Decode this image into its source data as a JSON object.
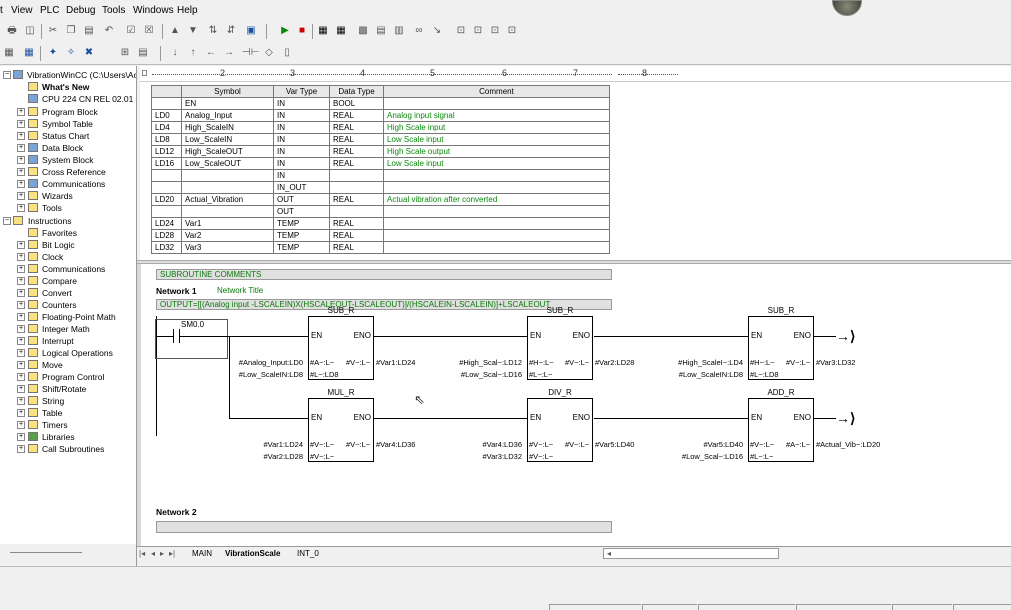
{
  "menu": [
    "t",
    "View",
    "PLC",
    "Debug",
    "Tools",
    "Windows",
    "Help"
  ],
  "toolbar": {
    "row1": [
      "printer-icon",
      "print-preview-icon",
      "cut-icon",
      "copy-icon",
      "paste-icon",
      "undo-icon",
      "compile-icon",
      "compile-all-icon",
      "upload-icon",
      "download-icon",
      "sort-asc-icon",
      "sort-desc-icon",
      "options-icon",
      "run-icon",
      "stop-icon",
      "program-status-icon",
      "chart-status-icon",
      "monitor-icon",
      "trend-icon",
      "force-icon",
      "glasses-icon",
      "unforce-icon",
      "lock-icon",
      "read-icon",
      "write-icon"
    ],
    "row2": [
      "ladder-icon",
      "stl-icon",
      "insert-network-icon",
      "delete-network-icon",
      "insert-col-icon",
      "symbol-icon",
      "symbol-table-icon",
      "line-down-icon",
      "line-up-icon",
      "line-left-icon",
      "line-right-icon",
      "contact-icon",
      "coil-icon",
      "box-icon"
    ]
  },
  "tree": {
    "root": "VibrationWinCC (C:\\Users\\Ac",
    "items": [
      {
        "label": "What's New",
        "bold": true
      },
      {
        "label": "CPU 224 CN REL 02.01"
      },
      {
        "label": "Program Block"
      },
      {
        "label": "Symbol Table"
      },
      {
        "label": "Status Chart"
      },
      {
        "label": "Data Block"
      },
      {
        "label": "System Block"
      },
      {
        "label": "Cross Reference"
      },
      {
        "label": "Communications"
      },
      {
        "label": "Wizards"
      },
      {
        "label": "Tools"
      }
    ],
    "instructions_label": "Instructions",
    "instructions": [
      "Favorites",
      "Bit Logic",
      "Clock",
      "Communications",
      "Compare",
      "Convert",
      "Counters",
      "Floating-Point Math",
      "Integer Math",
      "Interrupt",
      "Logical Operations",
      "Move",
      "Program Control",
      "Shift/Rotate",
      "String",
      "Table",
      "Timers",
      "Libraries",
      "Call Subroutines"
    ]
  },
  "ruler": [
    "2",
    "3",
    "4",
    "5",
    "6",
    "7",
    "8"
  ],
  "var_table": {
    "headers": [
      "",
      "Symbol",
      "Var Type",
      "Data Type",
      "Comment"
    ],
    "rows": [
      [
        "",
        "EN",
        "IN",
        "BOOL",
        ""
      ],
      [
        "LD0",
        "Analog_Input",
        "IN",
        "REAL",
        "Analog input signal"
      ],
      [
        "LD4",
        "High_ScaleIN",
        "IN",
        "REAL",
        "High Scale input"
      ],
      [
        "LD8",
        "Low_ScaleIN",
        "IN",
        "REAL",
        "Low Scale input"
      ],
      [
        "LD12",
        "High_ScaleOUT",
        "IN",
        "REAL",
        "High Scale output"
      ],
      [
        "LD16",
        "Low_ScaleOUT",
        "IN",
        "REAL",
        "Low Scale input"
      ],
      [
        "",
        "",
        "IN",
        "",
        ""
      ],
      [
        "",
        "",
        "IN_OUT",
        "",
        ""
      ],
      [
        "LD20",
        "Actual_Vibration",
        "OUT",
        "REAL",
        "Actual vibration after converted"
      ],
      [
        "",
        "",
        "OUT",
        "",
        ""
      ],
      [
        "LD24",
        "Var1",
        "TEMP",
        "REAL",
        ""
      ],
      [
        "LD28",
        "Var2",
        "TEMP",
        "REAL",
        ""
      ],
      [
        "LD32",
        "Var3",
        "TEMP",
        "REAL",
        ""
      ]
    ]
  },
  "editor": {
    "subroutine_comments": "SUBROUTINE COMMENTS",
    "network1": "Network 1",
    "network1_title": "Network Title",
    "formula": "OUTPUT=[[(Analog input -LSCALEIN)X(HSCALEOUT-LSCALEOUT)]/(HSCALEIN-LSCALEIN)]+LSCALEOUT",
    "contact": "SM0.0",
    "boxes": [
      {
        "name": "SUB_R",
        "in1": "#Analog_Input:LD0",
        "in2": "#Low_ScaleIN:LD8",
        "p1": "#A~:L~",
        "p2": "#L~:LD8",
        "po": "#V~:L~",
        "out": "#Var1:LD24"
      },
      {
        "name": "SUB_R",
        "in1": "#High_Scal~:LD12",
        "in2": "#Low_Scal~:LD16",
        "p1": "#H~:L~",
        "p2": "#L~:L~",
        "po": "#V~:L~",
        "out": "#Var2:LD28"
      },
      {
        "name": "SUB_R",
        "in1": "#High_ScaleI~:LD4",
        "in2": "#Low_ScaleIN:LD8",
        "p1": "#H~:L~",
        "p2": "#L~:LD8",
        "po": "#V~:L~",
        "out": "#Var3:LD32"
      },
      {
        "name": "MUL_R",
        "in1": "#Var1:LD24",
        "in2": "#Var2:LD28",
        "p1": "#V~:L~",
        "p2": "#V~:L~",
        "po": "#V~:L~",
        "out": "#Var4:LD36"
      },
      {
        "name": "DIV_R",
        "in1": "#Var4:LD36",
        "in2": "#Var3:LD32",
        "p1": "#V~:L~",
        "p2": "#V~:L~",
        "po": "#V~:L~",
        "out": "#Var5:LD40"
      },
      {
        "name": "ADD_R",
        "in1": "#Var5:LD40",
        "in2": "#Low_Scal~:LD16",
        "p1": "#V~:L~",
        "p2": "#L~:L~",
        "po": "#A~:L~",
        "out": "#Actual_Vib~:LD20"
      }
    ],
    "en": "EN",
    "eno": "ENO",
    "network2": "Network 2"
  },
  "tabs": [
    "MAIN",
    "VibrationScale",
    "INT_0"
  ]
}
